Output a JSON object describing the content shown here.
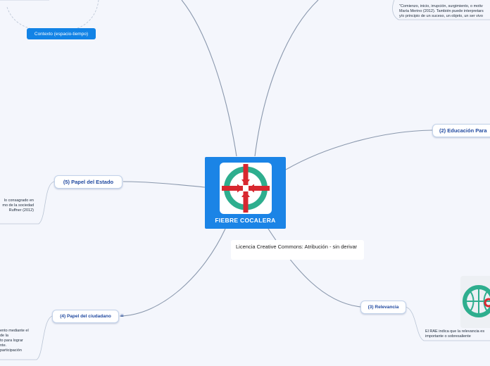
{
  "central": {
    "title": "FIEBRE COCALERA"
  },
  "license": {
    "text": "Licencia Creative Commons: Atribución - sin derivar"
  },
  "branches": {
    "educacion": "(2) Educación Para",
    "relevancia": "(3) Relevancia",
    "ciudadano": "(4) Papel del ciudadano",
    "estado": "(5) Papel del Estado",
    "contexto": "Contexto (espacio-tiempo)"
  },
  "notes": {
    "origen": [
      "\"Comienzo, inicio, irrupción, surgimiento, o motiv",
      "María Merino (2012). También puede interpretars",
      "y/o principio de un suceso, un objeto, un ser vivo"
    ],
    "relevancia": [
      "El RAE indica que la relevancia es",
      "importante o sobresaliente"
    ],
    "estado": [
      "lo consagrado en",
      "",
      "",
      "mo de la sociedad",
      "Ruffner (2012)"
    ],
    "ciudadano": [
      "ento mediante el",
      "de la",
      "to para lograr",
      "nte.",
      "participación"
    ]
  },
  "icons": {
    "logo": "red-cross-green-ring-logo",
    "world": "globe-logo",
    "notes": "hamburger-menu-icon"
  },
  "colors": {
    "background": "#f4f6fc",
    "central": "#1b84e6",
    "branch_text": "#214aa0",
    "line": "#8a98ad",
    "logo_red": "#d8272f",
    "logo_green": "#2eae8e"
  }
}
